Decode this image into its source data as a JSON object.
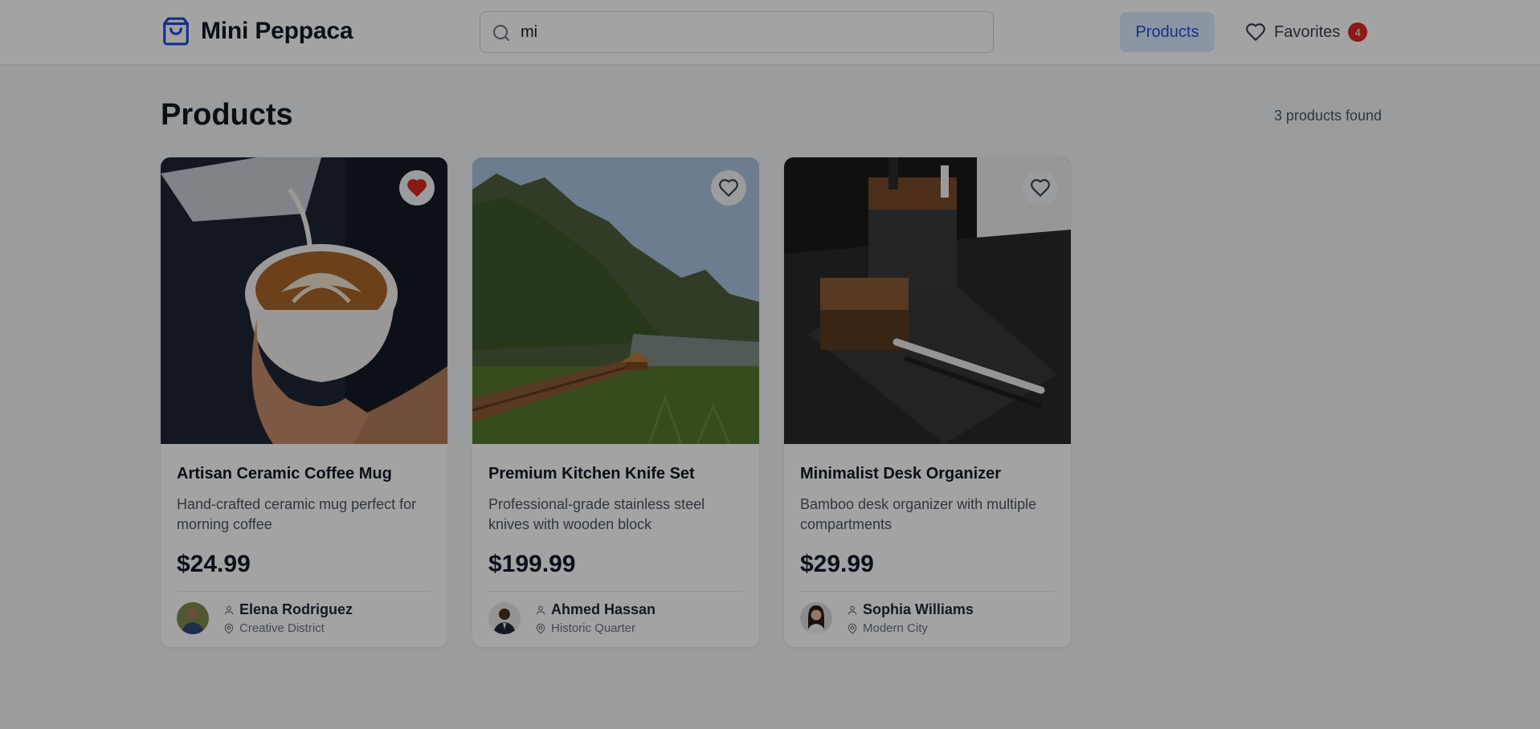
{
  "header": {
    "logo_text": "Mini Peppaca",
    "search_value": "mi",
    "nav_products": "Products",
    "nav_favorites": "Favorites",
    "favorites_count": "4"
  },
  "main": {
    "title": "Products",
    "count_text": "3 products found"
  },
  "products": [
    {
      "title": "Artisan Ceramic Coffee Mug",
      "description": "Hand-crafted ceramic mug perfect for morning coffee",
      "price": "$24.99",
      "seller": "Elena Rodriguez",
      "location": "Creative District",
      "favorited": true
    },
    {
      "title": "Premium Kitchen Knife Set",
      "description": "Professional-grade stainless steel knives with wooden block",
      "price": "$199.99",
      "seller": "Ahmed Hassan",
      "location": "Historic Quarter",
      "favorited": false
    },
    {
      "title": "Minimalist Desk Organizer",
      "description": "Bamboo desk organizer with multiple compartments",
      "price": "$29.99",
      "seller": "Sophia Williams",
      "location": "Modern City",
      "favorited": false
    }
  ],
  "colors": {
    "accent": "#1d4ed8",
    "accent_bg": "#dbeafe",
    "badge": "#dc2626",
    "favorite_heart": "#dc2626"
  },
  "icons": [
    "shopping-bag-icon",
    "search-icon",
    "heart-icon",
    "user-icon",
    "map-pin-icon"
  ]
}
